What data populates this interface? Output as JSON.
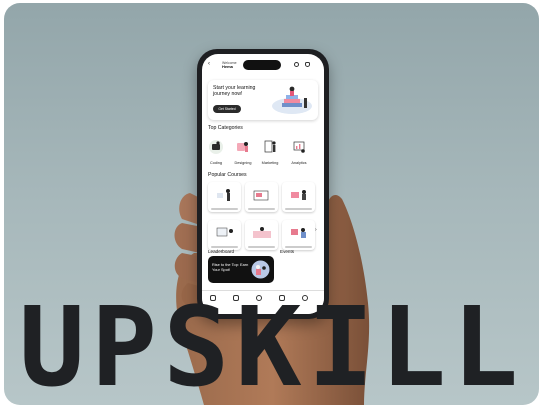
{
  "brand": {
    "wordmark": "UPSKILL"
  },
  "app": {
    "header": {
      "greeting": "Welcome",
      "name": "Hema"
    },
    "hero": {
      "title": "Start your learning journey now!",
      "button_label": "Get Started"
    },
    "categories": {
      "heading": "Top Categories",
      "items": [
        {
          "label": "Coding"
        },
        {
          "label": "Designing"
        },
        {
          "label": "Marketing"
        },
        {
          "label": "Analytics"
        }
      ]
    },
    "courses": {
      "heading": "Popular Courses"
    },
    "leaderboard": {
      "heading": "Leaderboard",
      "banner_text": "Rise to the Top: Earn Your Spot!"
    },
    "events": {
      "heading": "Events"
    }
  },
  "colors": {
    "background": "#a7b8bb",
    "phone": "#1e1f22",
    "wordmark": "#1f2124",
    "accent": "#e77a8e"
  }
}
